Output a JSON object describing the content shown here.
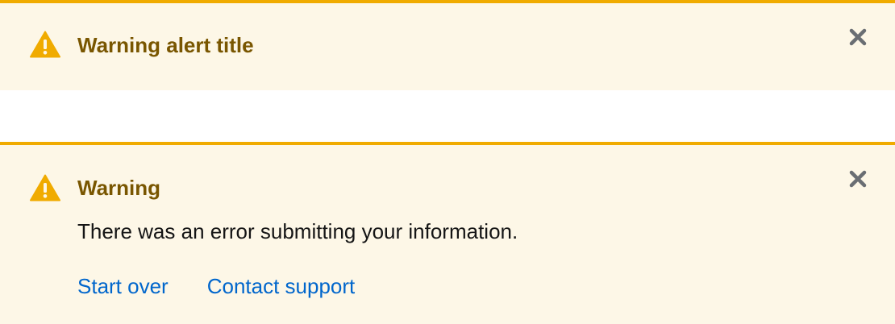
{
  "colors": {
    "alert_background": "#fdf7e7",
    "alert_border": "#f0ab00",
    "title_text": "#795600",
    "body_text": "#151515",
    "link": "#0066cc",
    "close_icon": "#6a6e73"
  },
  "alerts": [
    {
      "icon": "warning-triangle-icon",
      "title": "Warning alert title",
      "close_icon": "close-icon"
    },
    {
      "icon": "warning-triangle-icon",
      "title": "Warning",
      "description": "There was an error submitting your information.",
      "actions": [
        {
          "label": "Start over"
        },
        {
          "label": "Contact support"
        }
      ],
      "close_icon": "close-icon"
    }
  ]
}
